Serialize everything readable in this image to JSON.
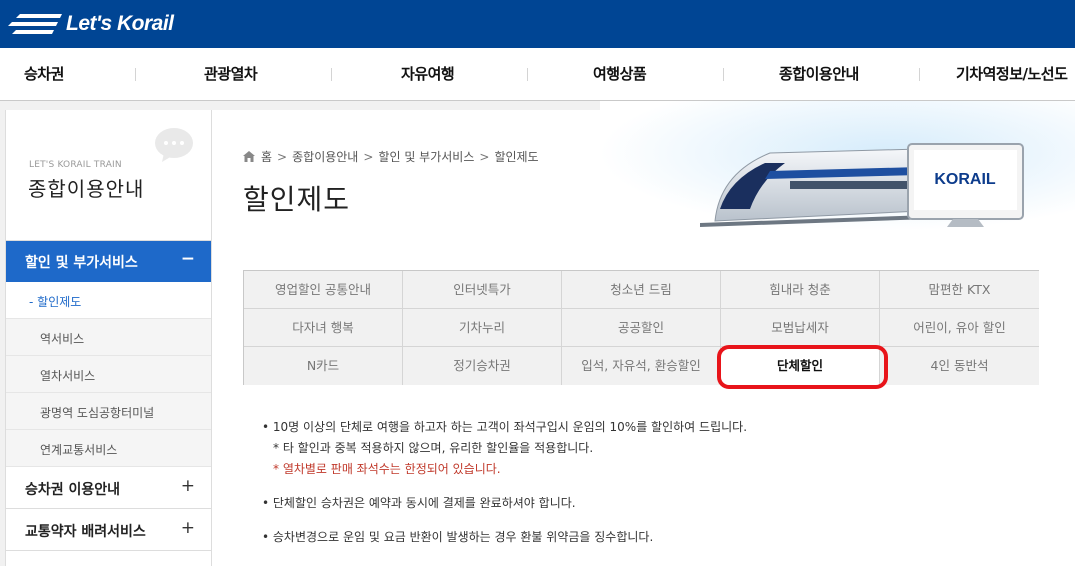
{
  "brand": {
    "logo_text": "Let's Korail",
    "hero_logo": "KORAIL"
  },
  "gnb": [
    "승차권",
    "관광열차",
    "자유여행",
    "여행상품",
    "종합이용안내",
    "기차역정보/노선도"
  ],
  "sidebar": {
    "subtitle": "LET'S KORAIL TRAIN",
    "title": "종합이용안내",
    "active_menu": {
      "label": "할인 및 부가서비스",
      "toggle": "−"
    },
    "sub_items": [
      "할인제도",
      "역서비스",
      "열차서비스",
      "광명역 도심공항터미널",
      "연계교통서비스"
    ],
    "current_marker": "-",
    "menus": [
      {
        "label": "승차권 이용안내",
        "toggle": "+"
      },
      {
        "label": "교통약자 배려서비스",
        "toggle": "+"
      }
    ]
  },
  "breadcrumb": [
    "홈",
    "종합이용안내",
    "할인 및 부가서비스",
    "할인제도"
  ],
  "breadcrumb_sep": ">",
  "page_title": "할인제도",
  "tabs": [
    [
      "영업할인 공통안내",
      "인터넷특가",
      "청소년 드림",
      "힘내라 청춘",
      "맘편한 KTX"
    ],
    [
      "다자녀 행복",
      "기차누리",
      "공공할인",
      "모범납세자",
      "어린이, 유아 할인"
    ],
    [
      "N카드",
      "정기승차권",
      "입석, 자유석, 환승할인",
      "단체할인",
      "4인 동반석"
    ]
  ],
  "active_tab": "단체할인",
  "content": {
    "bullet1": "• 10명 이상의 단체로 여행을 하고자 하는 고객이 좌석구입시 운임의 10%를 할인하여 드립니다.",
    "note1": "* 타 할인과 중복 적용하지 않으며, 유리한 할인율을 적용합니다.",
    "note2": "* 열차별로 판매 좌석수는 한정되어 있습니다.",
    "bullet2": "• 단체할인 승차권은 예약과 동시에 결제를 완료하셔야 합니다.",
    "bullet3": "• 승차변경으로 운임 및 요금 반환이 발생하는 경우 환불 위약금을 징수합니다."
  },
  "colors": {
    "brand_blue": "#004594",
    "menu_active": "#1e69c9",
    "note_red": "#c0392b",
    "highlight": "#e8141a"
  }
}
